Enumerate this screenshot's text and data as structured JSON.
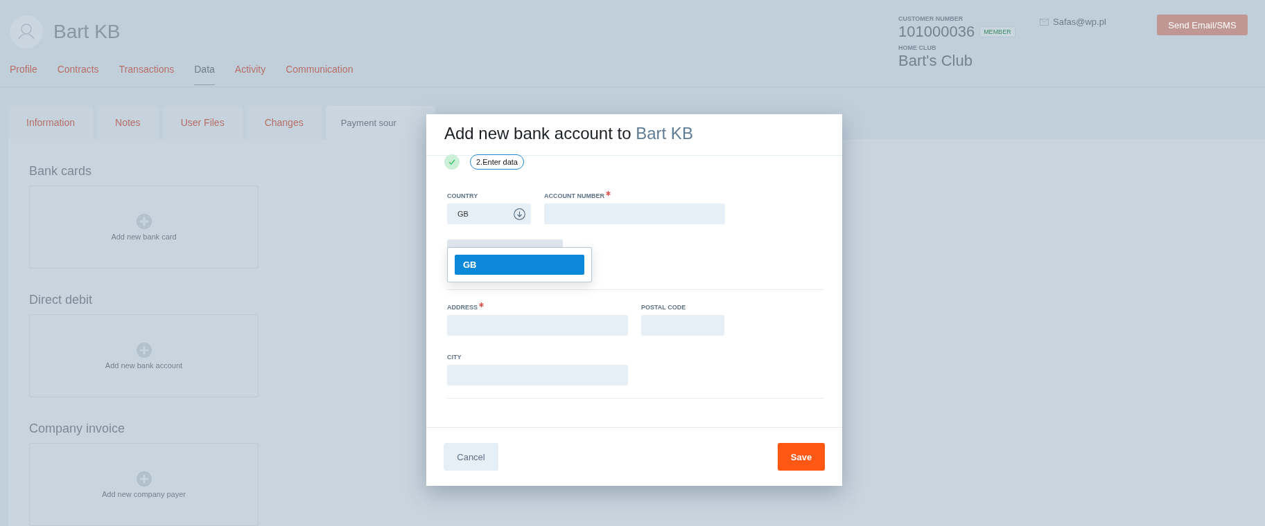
{
  "header": {
    "name": "Bart KB",
    "customer_number_label": "CUSTOMER NUMBER",
    "customer_number": "101000036",
    "badge": "MEMBER",
    "home_club_label": "HOME CLUB",
    "home_club": "Bart's Club",
    "email": "Safas@wp.pl",
    "send_button": "Send Email/SMS"
  },
  "nav_tabs": [
    {
      "label": "Profile",
      "selected": false
    },
    {
      "label": "Contracts",
      "selected": false
    },
    {
      "label": "Transactions",
      "selected": false
    },
    {
      "label": "Data",
      "selected": true
    },
    {
      "label": "Activity",
      "selected": false
    },
    {
      "label": "Communication",
      "selected": false
    }
  ],
  "sub_tabs": [
    {
      "label": "Information",
      "selected": false
    },
    {
      "label": "Notes",
      "selected": false
    },
    {
      "label": "User Files",
      "selected": false
    },
    {
      "label": "Changes",
      "selected": false
    },
    {
      "label": "Payment sour",
      "selected": true
    }
  ],
  "sections": [
    {
      "title": "Bank cards",
      "action": "Add new bank card"
    },
    {
      "title": "Direct debit",
      "action": "Add new bank account"
    },
    {
      "title": "Company invoice",
      "action": "Add new company payer"
    }
  ],
  "modal": {
    "title": "Add new bank account to",
    "title_name": "Bart KB",
    "steps": [
      {
        "done": true
      },
      {
        "done": false,
        "label": "2.Enter data"
      }
    ],
    "top_fields": [
      {
        "label": "COUNTRY",
        "required": false,
        "kind": "select",
        "value": "GB"
      },
      {
        "label": "ACCOUNT NUMBER",
        "required": true,
        "kind": "text"
      }
    ],
    "dropdown": {
      "options": [
        {
          "label": "GB",
          "selected": true
        }
      ]
    },
    "address_rows": [
      [
        {
          "label": "ADDRESS",
          "required": true,
          "kind": "text"
        },
        {
          "label": "POSTAL CODE",
          "required": false,
          "kind": "text"
        }
      ],
      [
        {
          "label": "CITY",
          "required": false,
          "kind": "text"
        }
      ]
    ],
    "cancel_button": "Cancel",
    "save_button": "Save"
  }
}
